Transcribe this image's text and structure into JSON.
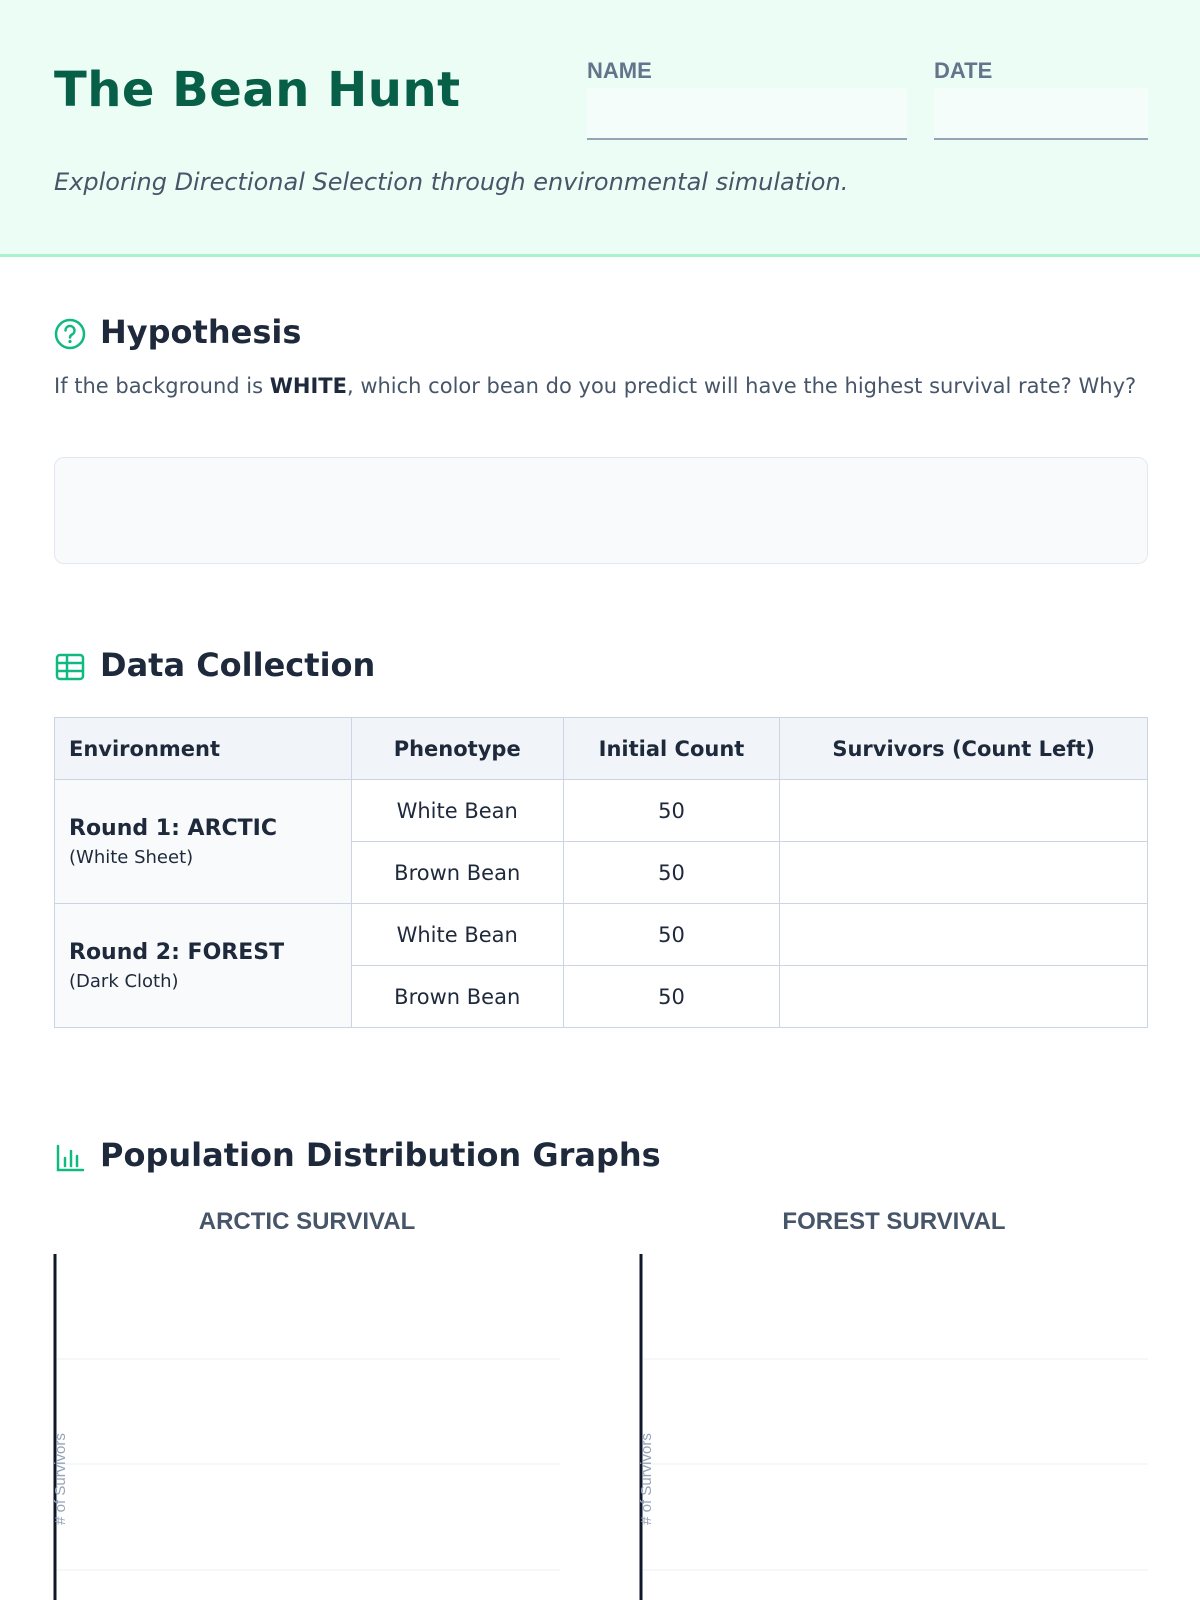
{
  "header": {
    "title": "The Bean Hunt",
    "name_label": "NAME",
    "name_value": "",
    "date_label": "DATE",
    "date_value": "",
    "subtitle": "Exploring Directional Selection through environmental simulation."
  },
  "hypothesis": {
    "icon": "question-circle-icon",
    "title": "Hypothesis",
    "prompt_before": "If the background is ",
    "prompt_bold": "WHITE",
    "prompt_after": ", which color bean do you predict will have the highest survival rate? Why?",
    "answer_value": ""
  },
  "data_collection": {
    "icon": "table-icon",
    "title": "Data Collection",
    "columns": [
      "Environment",
      "Phenotype",
      "Initial Count",
      "Survivors (Count Left)"
    ],
    "rounds": [
      {
        "name": "Round 1: ARCTIC",
        "sub": "(White Sheet)",
        "rows": [
          {
            "phenotype": "White Bean",
            "initial": "50",
            "survivors": ""
          },
          {
            "phenotype": "Brown Bean",
            "initial": "50",
            "survivors": ""
          }
        ]
      },
      {
        "name": "Round 2: FOREST",
        "sub": "(Dark Cloth)",
        "rows": [
          {
            "phenotype": "White Bean",
            "initial": "50",
            "survivors": ""
          },
          {
            "phenotype": "Brown Bean",
            "initial": "50",
            "survivors": ""
          }
        ]
      }
    ]
  },
  "graphs": {
    "icon": "bar-chart-icon",
    "title": "Population Distribution Graphs"
  },
  "chart_data": [
    {
      "type": "bar",
      "title": "ARCTIC SURVIVAL",
      "ylabel": "# of Survivors",
      "categories": [],
      "values": [],
      "grid": true
    },
    {
      "type": "bar",
      "title": "FOREST SURVIVAL",
      "ylabel": "# of Survivors",
      "categories": [],
      "values": [],
      "grid": true
    }
  ],
  "colors": {
    "brand": "#065f46",
    "accent": "#10b981",
    "header_bg": "#ecfdf5"
  }
}
